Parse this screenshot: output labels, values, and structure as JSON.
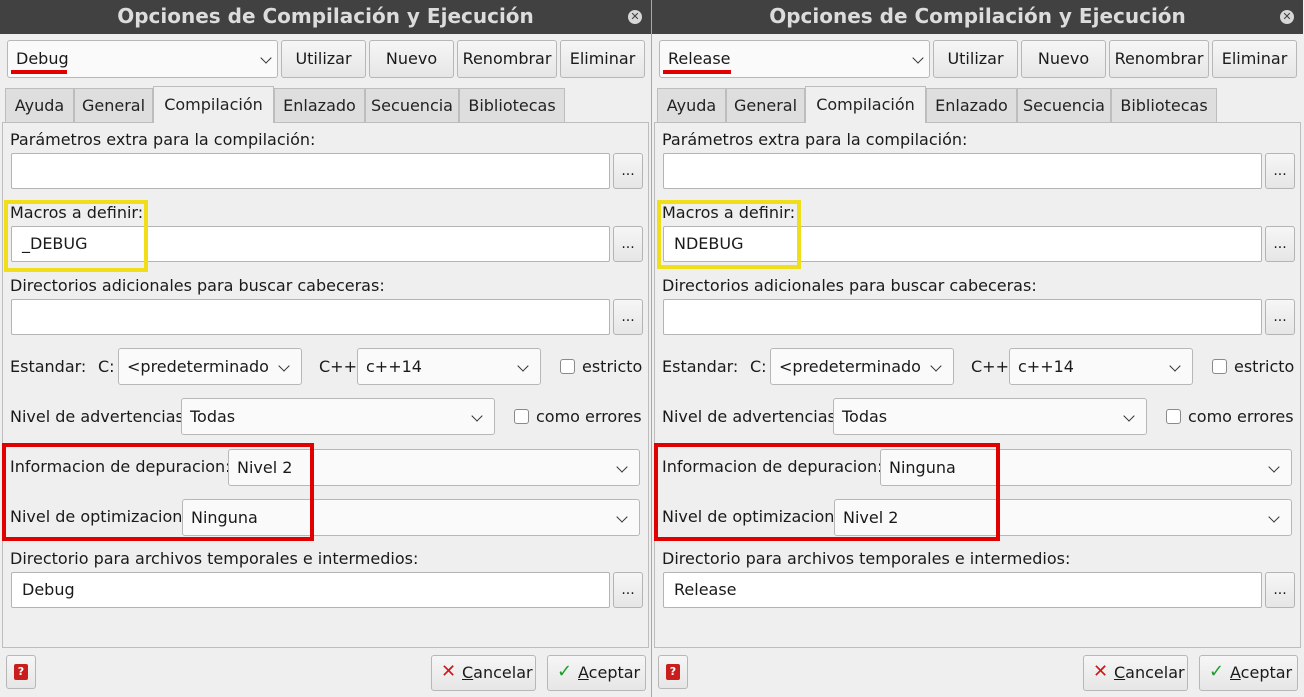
{
  "panels": [
    {
      "title": "Opciones de Compilación y Ejecución",
      "profile": "Debug",
      "toolbar": {
        "use": "Utilizar",
        "new": "Nuevo",
        "rename": "Renombrar",
        "delete": "Eliminar"
      },
      "tabs": [
        "Ayuda",
        "General",
        "Compilación",
        "Enlazado",
        "Secuencia",
        "Bibliotecas"
      ],
      "active_tab": "Compilación",
      "extra_params_label": "Parámetros extra para la compilación:",
      "extra_params_value": "",
      "dots": "...",
      "macros_label": "Macros a definir:",
      "macros_value": "_DEBUG",
      "include_dirs_label": "Directorios adicionales para buscar cabeceras:",
      "include_dirs_value": "",
      "standard_label": "Estandar:",
      "c_label": "C:",
      "c_value": "<predeterminado",
      "cpp_label": "C++:",
      "cpp_value": "c++14",
      "strict_label": "estricto",
      "strict_checked": false,
      "warnings_label": "Nivel de advertencias:",
      "warnings_value": "Todas",
      "as_errors_label": "como errores",
      "as_errors_checked": false,
      "debug_info_label": "Informacion de depuracion:",
      "debug_info_value": "Nivel 2",
      "optimization_label": "Nivel de optimizacion:",
      "optimization_value": "Ninguna",
      "temp_dir_label": "Directorio para archivos temporales e intermedios:",
      "temp_dir_value": "Debug",
      "help_icon": "zinjai-help-icon",
      "cancel": "ancelar",
      "cancel_mnemonic": "C",
      "accept": "ceptar",
      "accept_mnemonic": "A"
    },
    {
      "title": "Opciones de Compilación y Ejecución",
      "profile": "Release",
      "toolbar": {
        "use": "Utilizar",
        "new": "Nuevo",
        "rename": "Renombrar",
        "delete": "Eliminar"
      },
      "tabs": [
        "Ayuda",
        "General",
        "Compilación",
        "Enlazado",
        "Secuencia",
        "Bibliotecas"
      ],
      "active_tab": "Compilación",
      "extra_params_label": "Parámetros extra para la compilación:",
      "extra_params_value": "",
      "dots": "...",
      "macros_label": "Macros a definir:",
      "macros_value": "NDEBUG",
      "include_dirs_label": "Directorios adicionales para buscar cabeceras:",
      "include_dirs_value": "",
      "standard_label": "Estandar:",
      "c_label": "C:",
      "c_value": "<predeterminado",
      "cpp_label": "C++:",
      "cpp_value": "c++14",
      "strict_label": "estricto",
      "strict_checked": false,
      "warnings_label": "Nivel de advertencias:",
      "warnings_value": "Todas",
      "as_errors_label": "como errores",
      "as_errors_checked": false,
      "debug_info_label": "Informacion de depuracion:",
      "debug_info_value": "Ninguna",
      "optimization_label": "Nivel de optimizacion:",
      "optimization_value": "Nivel 2",
      "temp_dir_label": "Directorio para archivos temporales e intermedios:",
      "temp_dir_value": "Release",
      "help_icon": "zinjai-help-icon",
      "cancel": "ancelar",
      "cancel_mnemonic": "C",
      "accept": "ceptar",
      "accept_mnemonic": "A"
    }
  ],
  "colors": {
    "highlight_yellow": "#f1de1a",
    "highlight_red": "#e00000",
    "titlebar": "#414141"
  }
}
